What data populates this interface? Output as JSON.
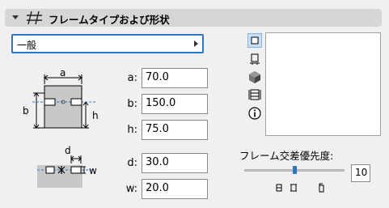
{
  "section": {
    "title": "フレームタイプおよび形状",
    "collapse_icon": "triangle-down-icon",
    "icon": "frame-type-icon"
  },
  "type_dropdown": {
    "value": "一般"
  },
  "section_diagram": {
    "dim_labels": {
      "a": "a",
      "b": "b",
      "h": "h"
    }
  },
  "offset_diagram": {
    "dim_labels": {
      "d": "d",
      "w": "w"
    }
  },
  "params": [
    {
      "label": "a:",
      "value": "70.0"
    },
    {
      "label": "b:",
      "value": "150.0"
    },
    {
      "label": "h:",
      "value": "75.0"
    },
    {
      "label": "d:",
      "value": "30.0"
    },
    {
      "label": "w:",
      "value": "20.0"
    }
  ],
  "view_tools": [
    "square-view-icon",
    "profile-view-icon",
    "3d-view-icon",
    "frame-view-icon",
    "info-icon"
  ],
  "priority": {
    "label": "フレーム交差優先度:",
    "value": "10",
    "slider_fraction": 0.5,
    "tick_icons": [
      "low-priority-icon",
      "mid-priority-icon",
      "high-priority-icon"
    ]
  },
  "colors": {
    "accent": "#2f76c9",
    "header_bg": "#d6d6d6",
    "panel_bg": "#f0f0f0"
  }
}
